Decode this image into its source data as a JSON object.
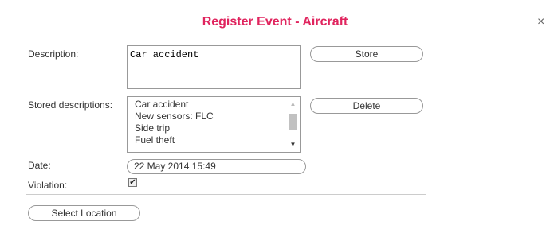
{
  "dialog": {
    "title": "Register Event - Aircraft",
    "close_glyph": "×"
  },
  "form": {
    "description_label": "Description:",
    "description_value": "Car accident",
    "store_label": "Store",
    "stored_descriptions_label": "Stored descriptions:",
    "stored_descriptions": [
      "Car accident",
      "New sensors: FLC",
      "Side trip",
      "Fuel theft"
    ],
    "delete_label": "Delete",
    "date_label": "Date:",
    "date_value": "22 May 2014 15:49",
    "violation_label": "Violation:",
    "violation_checked": true,
    "select_location_label": "Select Location"
  },
  "icons": {
    "close": "close-icon",
    "scroll_up": "scroll-up-arrow-icon",
    "scroll_down": "scroll-down-arrow-icon",
    "checkmark": "checkmark-icon"
  }
}
